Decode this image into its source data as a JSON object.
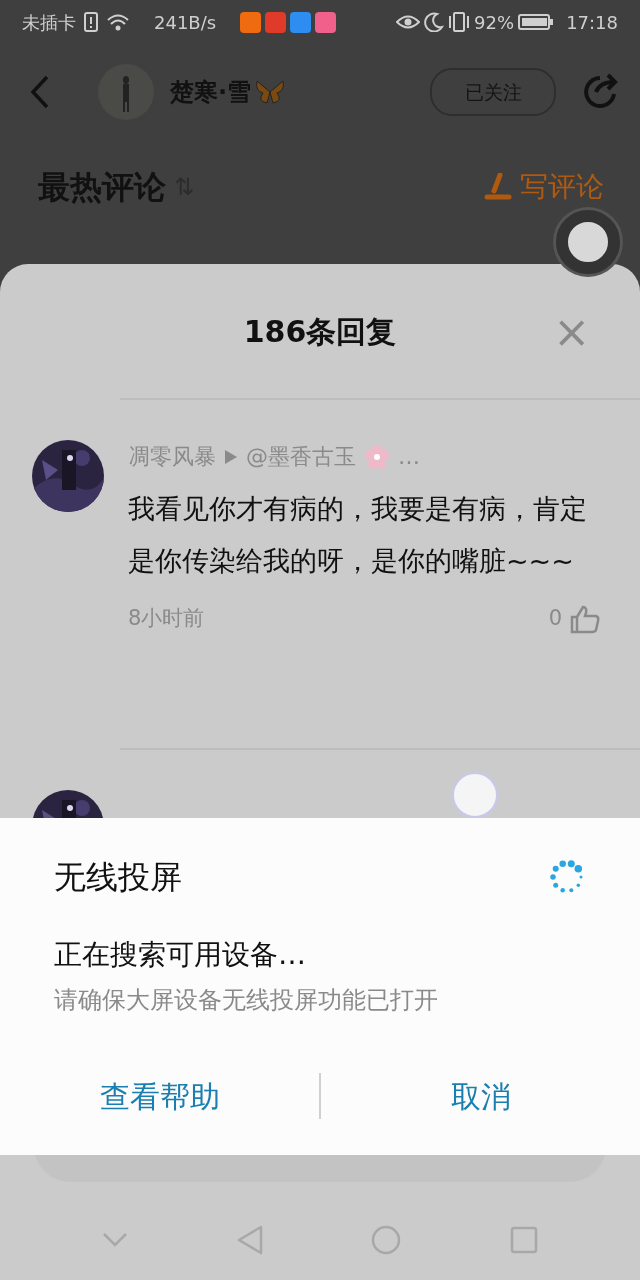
{
  "status_bar": {
    "carrier": "未插卡",
    "speed": "241B/s",
    "battery": "92%",
    "time": "17:18"
  },
  "header": {
    "user_name": "楚寒·雪",
    "follow_button": "已关注"
  },
  "section": {
    "title": "最热评论",
    "sort_icon": "⇅",
    "write_button": "写评论"
  },
  "sheet": {
    "title": "186条回复",
    "close": "×"
  },
  "comments": [
    {
      "author": "凋零风暴",
      "reply_to": "@墨香古玉",
      "more": "…",
      "text": "我看见你才有病的，我要是有病，肯定是你传染给我的呀，是你的嘴脏~~~",
      "time": "8小时前",
      "likes": "0"
    }
  ],
  "dialog": {
    "title": "无线投屏",
    "status": "正在搜索可用设备…",
    "hint": "请确保大屏设备无线投屏功能已打开",
    "buttons": [
      "查看帮助",
      "取消"
    ]
  }
}
